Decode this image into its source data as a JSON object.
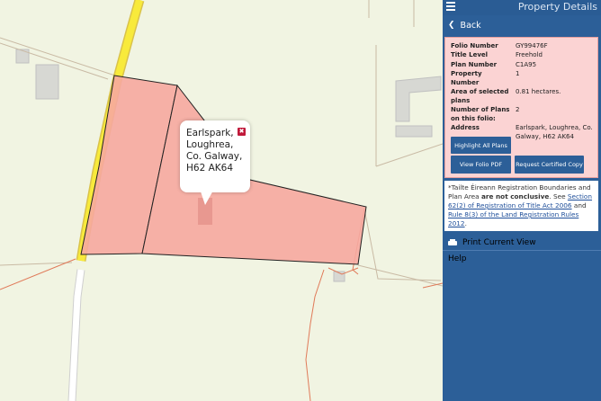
{
  "panel": {
    "title": "Property Details",
    "back_label": "Back",
    "print_label": "Print Current View",
    "help_label": "Help"
  },
  "popup": {
    "address": "Earlspark,\nLoughrea,\nCo. Galway,\nH62 AK64",
    "close_symbol": "✖"
  },
  "details": [
    {
      "key": "Folio Number",
      "value": "GY99476F"
    },
    {
      "key": "Title Level",
      "value": "Freehold"
    },
    {
      "key": "Plan Number",
      "value": "C1A95"
    },
    {
      "key": "Property Number",
      "value": "1"
    },
    {
      "key": "Area of selected plans",
      "value": "0.81 hectares."
    },
    {
      "key": "Number of Plans on this folio:",
      "value": "2"
    },
    {
      "key": "Address",
      "value": "Earlspark, Loughrea, Co. Galway, H62 AK64"
    }
  ],
  "buttons": {
    "highlight_all": "Highlight All Plans",
    "view_pdf": "View Folio PDF",
    "request_copy": "Request Certified Copy"
  },
  "notice": {
    "intro": "*Tailte Éireann Registration Boundaries and Plan Area ",
    "bold": "are not conclusive",
    "mid": ". See ",
    "link1": "Section 62(2) of Registration of Title Act 2006",
    "and": " and ",
    "link2": "Rule 8(3) of the Land Registration Rules 2012",
    "end": "."
  },
  "colors": {
    "panel_bg": "#2c5f98",
    "info_bg": "#fbd3d3",
    "parcel_fill": "#f6a9a0",
    "road_yellow": "#f8ea3b",
    "map_bg": "#f1f4e2"
  }
}
